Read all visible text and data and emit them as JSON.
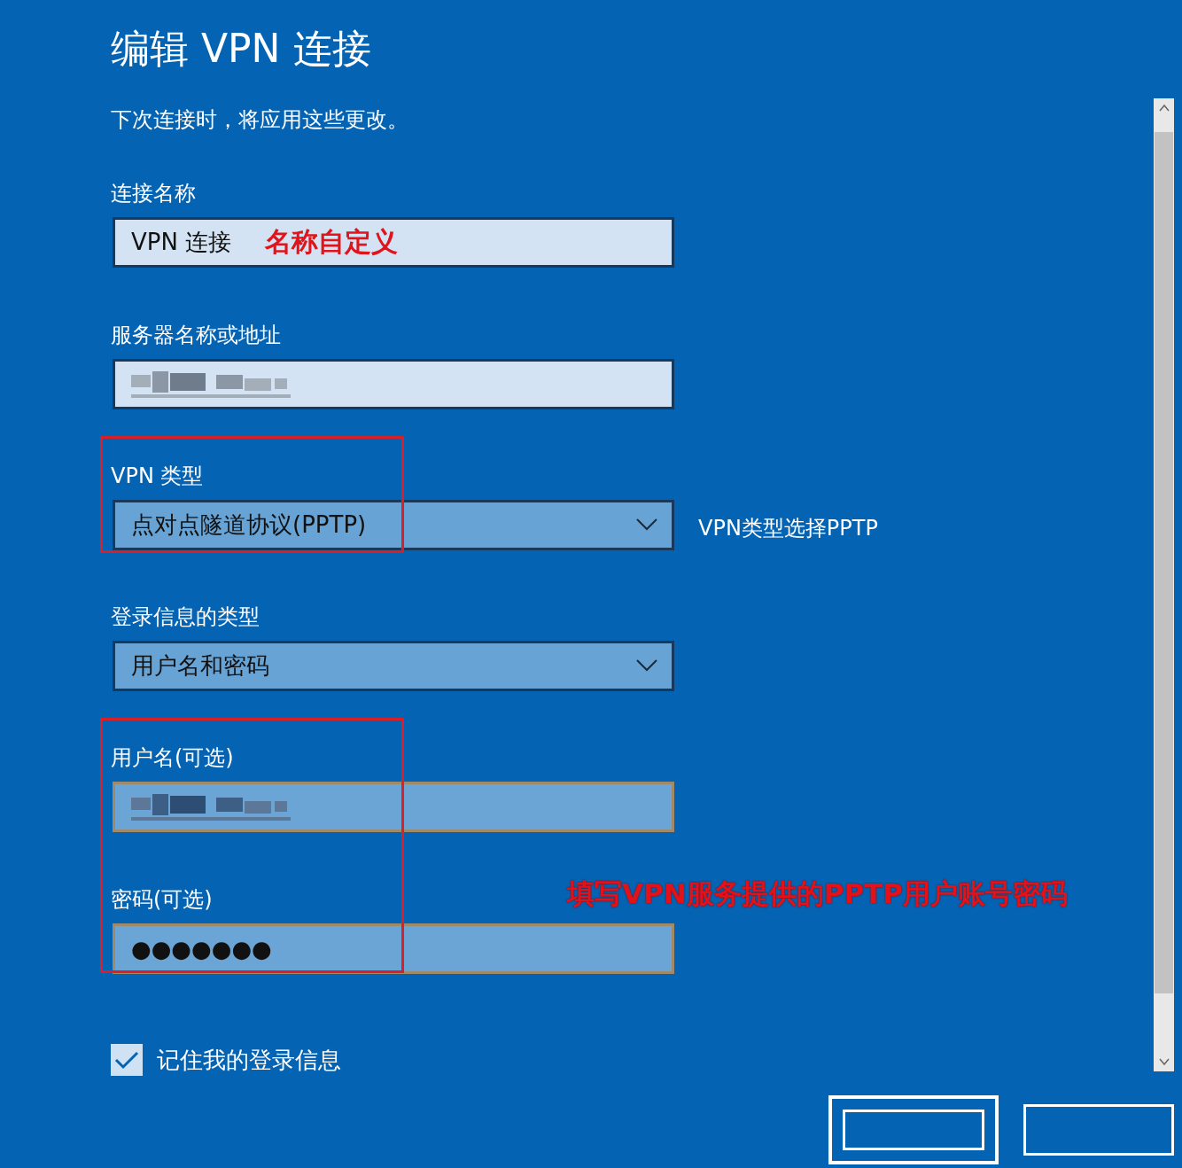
{
  "title": "编辑 VPN 连接",
  "subtitle": "下次连接时，将应用这些更改。",
  "sections": [
    {
      "highlighted": false,
      "fields": [
        {
          "kind": "text",
          "label": "连接名称",
          "value": "VPN 连接",
          "annotation": "名称自定义",
          "redacted": false
        }
      ]
    },
    {
      "highlighted": false,
      "fields": [
        {
          "kind": "text",
          "label": "服务器名称或地址",
          "redacted": true
        }
      ]
    },
    {
      "highlighted": true,
      "note": "VPN类型选择PPTP",
      "fields": [
        {
          "kind": "dropdown",
          "label": "VPN 类型",
          "value": "点对点隧道协议(PPTP)",
          "redacted": false
        }
      ]
    },
    {
      "highlighted": false,
      "fields": [
        {
          "kind": "dropdown",
          "label": "登录信息的类型",
          "value": "用户名和密码",
          "redacted": false
        }
      ]
    },
    {
      "highlighted": true,
      "warning": "填写VPN服务提供的PPTP用户账号密码",
      "fields": [
        {
          "kind": "account",
          "label": "用户名(可选)",
          "redacted": true
        },
        {
          "kind": "account",
          "label": "密码(可选)",
          "value": "●●●●●●●",
          "redacted": false
        }
      ]
    }
  ],
  "remember": {
    "label": "记住我的登录信息",
    "checked": true
  },
  "buttons": [
    {
      "kind": "primary"
    },
    {
      "kind": "secondary"
    }
  ]
}
